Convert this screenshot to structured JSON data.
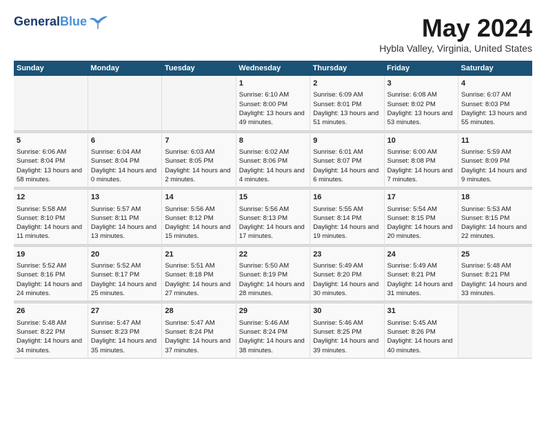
{
  "header": {
    "logo_line1": "General",
    "logo_line2": "Blue",
    "month_year": "May 2024",
    "location": "Hybla Valley, Virginia, United States"
  },
  "days_of_week": [
    "Sunday",
    "Monday",
    "Tuesday",
    "Wednesday",
    "Thursday",
    "Friday",
    "Saturday"
  ],
  "weeks": [
    {
      "days": [
        {
          "num": "",
          "empty": true
        },
        {
          "num": "",
          "empty": true
        },
        {
          "num": "",
          "empty": true
        },
        {
          "num": "1",
          "sunrise": "Sunrise: 6:10 AM",
          "sunset": "Sunset: 8:00 PM",
          "daylight": "Daylight: 13 hours and 49 minutes."
        },
        {
          "num": "2",
          "sunrise": "Sunrise: 6:09 AM",
          "sunset": "Sunset: 8:01 PM",
          "daylight": "Daylight: 13 hours and 51 minutes."
        },
        {
          "num": "3",
          "sunrise": "Sunrise: 6:08 AM",
          "sunset": "Sunset: 8:02 PM",
          "daylight": "Daylight: 13 hours and 53 minutes."
        },
        {
          "num": "4",
          "sunrise": "Sunrise: 6:07 AM",
          "sunset": "Sunset: 8:03 PM",
          "daylight": "Daylight: 13 hours and 55 minutes."
        }
      ]
    },
    {
      "days": [
        {
          "num": "5",
          "sunrise": "Sunrise: 6:06 AM",
          "sunset": "Sunset: 8:04 PM",
          "daylight": "Daylight: 13 hours and 58 minutes."
        },
        {
          "num": "6",
          "sunrise": "Sunrise: 6:04 AM",
          "sunset": "Sunset: 8:04 PM",
          "daylight": "Daylight: 14 hours and 0 minutes."
        },
        {
          "num": "7",
          "sunrise": "Sunrise: 6:03 AM",
          "sunset": "Sunset: 8:05 PM",
          "daylight": "Daylight: 14 hours and 2 minutes."
        },
        {
          "num": "8",
          "sunrise": "Sunrise: 6:02 AM",
          "sunset": "Sunset: 8:06 PM",
          "daylight": "Daylight: 14 hours and 4 minutes."
        },
        {
          "num": "9",
          "sunrise": "Sunrise: 6:01 AM",
          "sunset": "Sunset: 8:07 PM",
          "daylight": "Daylight: 14 hours and 6 minutes."
        },
        {
          "num": "10",
          "sunrise": "Sunrise: 6:00 AM",
          "sunset": "Sunset: 8:08 PM",
          "daylight": "Daylight: 14 hours and 7 minutes."
        },
        {
          "num": "11",
          "sunrise": "Sunrise: 5:59 AM",
          "sunset": "Sunset: 8:09 PM",
          "daylight": "Daylight: 14 hours and 9 minutes."
        }
      ]
    },
    {
      "days": [
        {
          "num": "12",
          "sunrise": "Sunrise: 5:58 AM",
          "sunset": "Sunset: 8:10 PM",
          "daylight": "Daylight: 14 hours and 11 minutes."
        },
        {
          "num": "13",
          "sunrise": "Sunrise: 5:57 AM",
          "sunset": "Sunset: 8:11 PM",
          "daylight": "Daylight: 14 hours and 13 minutes."
        },
        {
          "num": "14",
          "sunrise": "Sunrise: 5:56 AM",
          "sunset": "Sunset: 8:12 PM",
          "daylight": "Daylight: 14 hours and 15 minutes."
        },
        {
          "num": "15",
          "sunrise": "Sunrise: 5:56 AM",
          "sunset": "Sunset: 8:13 PM",
          "daylight": "Daylight: 14 hours and 17 minutes."
        },
        {
          "num": "16",
          "sunrise": "Sunrise: 5:55 AM",
          "sunset": "Sunset: 8:14 PM",
          "daylight": "Daylight: 14 hours and 19 minutes."
        },
        {
          "num": "17",
          "sunrise": "Sunrise: 5:54 AM",
          "sunset": "Sunset: 8:15 PM",
          "daylight": "Daylight: 14 hours and 20 minutes."
        },
        {
          "num": "18",
          "sunrise": "Sunrise: 5:53 AM",
          "sunset": "Sunset: 8:15 PM",
          "daylight": "Daylight: 14 hours and 22 minutes."
        }
      ]
    },
    {
      "days": [
        {
          "num": "19",
          "sunrise": "Sunrise: 5:52 AM",
          "sunset": "Sunset: 8:16 PM",
          "daylight": "Daylight: 14 hours and 24 minutes."
        },
        {
          "num": "20",
          "sunrise": "Sunrise: 5:52 AM",
          "sunset": "Sunset: 8:17 PM",
          "daylight": "Daylight: 14 hours and 25 minutes."
        },
        {
          "num": "21",
          "sunrise": "Sunrise: 5:51 AM",
          "sunset": "Sunset: 8:18 PM",
          "daylight": "Daylight: 14 hours and 27 minutes."
        },
        {
          "num": "22",
          "sunrise": "Sunrise: 5:50 AM",
          "sunset": "Sunset: 8:19 PM",
          "daylight": "Daylight: 14 hours and 28 minutes."
        },
        {
          "num": "23",
          "sunrise": "Sunrise: 5:49 AM",
          "sunset": "Sunset: 8:20 PM",
          "daylight": "Daylight: 14 hours and 30 minutes."
        },
        {
          "num": "24",
          "sunrise": "Sunrise: 5:49 AM",
          "sunset": "Sunset: 8:21 PM",
          "daylight": "Daylight: 14 hours and 31 minutes."
        },
        {
          "num": "25",
          "sunrise": "Sunrise: 5:48 AM",
          "sunset": "Sunset: 8:21 PM",
          "daylight": "Daylight: 14 hours and 33 minutes."
        }
      ]
    },
    {
      "days": [
        {
          "num": "26",
          "sunrise": "Sunrise: 5:48 AM",
          "sunset": "Sunset: 8:22 PM",
          "daylight": "Daylight: 14 hours and 34 minutes."
        },
        {
          "num": "27",
          "sunrise": "Sunrise: 5:47 AM",
          "sunset": "Sunset: 8:23 PM",
          "daylight": "Daylight: 14 hours and 35 minutes."
        },
        {
          "num": "28",
          "sunrise": "Sunrise: 5:47 AM",
          "sunset": "Sunset: 8:24 PM",
          "daylight": "Daylight: 14 hours and 37 minutes."
        },
        {
          "num": "29",
          "sunrise": "Sunrise: 5:46 AM",
          "sunset": "Sunset: 8:24 PM",
          "daylight": "Daylight: 14 hours and 38 minutes."
        },
        {
          "num": "30",
          "sunrise": "Sunrise: 5:46 AM",
          "sunset": "Sunset: 8:25 PM",
          "daylight": "Daylight: 14 hours and 39 minutes."
        },
        {
          "num": "31",
          "sunrise": "Sunrise: 5:45 AM",
          "sunset": "Sunset: 8:26 PM",
          "daylight": "Daylight: 14 hours and 40 minutes."
        },
        {
          "num": "",
          "empty": true
        }
      ]
    }
  ]
}
